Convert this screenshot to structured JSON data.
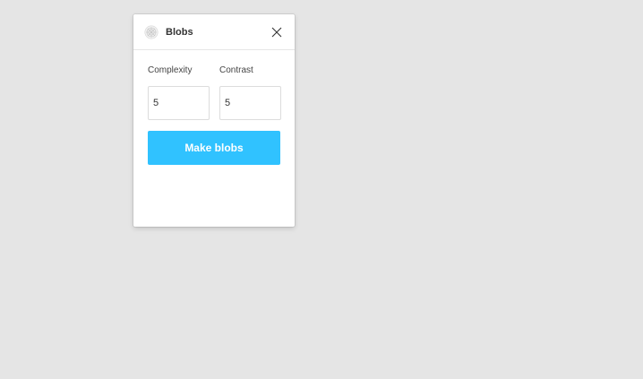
{
  "plugin": {
    "title": "Blobs",
    "icon": "blob-icon",
    "close_icon": "close-icon"
  },
  "fields": {
    "complexity": {
      "label": "Complexity",
      "value": "5"
    },
    "contrast": {
      "label": "Contrast",
      "value": "5"
    }
  },
  "actions": {
    "make_blobs_label": "Make blobs"
  },
  "colors": {
    "background": "#e5e5e5",
    "panel": "#ffffff",
    "accent": "#30c2ff",
    "text": "#333333"
  }
}
